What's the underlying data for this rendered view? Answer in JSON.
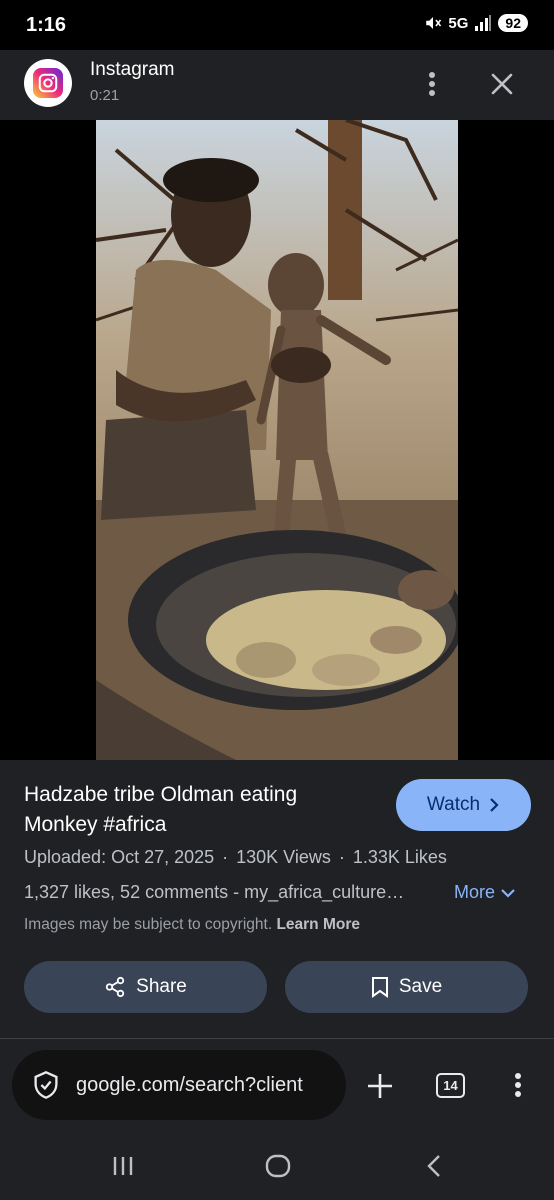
{
  "status_bar": {
    "time": "1:16",
    "network": "5G",
    "battery": "92"
  },
  "header": {
    "app_name": "Instagram",
    "duration": "0:21",
    "app_icon": "instagram-icon",
    "menu_icon": "more-vert-icon",
    "close_icon": "close-icon"
  },
  "media": {
    "image_icon": "video-thumbnail"
  },
  "info": {
    "title": "Hadzabe tribe Oldman eating Monkey #africa",
    "watch_label": "Watch",
    "uploaded": "Uploaded: Oct 27, 2025",
    "views": "130K Views",
    "likes": "1.33K Likes",
    "separator": "·",
    "description": "1,327 likes, 52 comments - my_africa_culture…",
    "more_label": "More",
    "copyright_text": "Images may be subject to copyright.",
    "learn_more": "Learn More",
    "share_label": "Share",
    "save_label": "Save"
  },
  "browser_bar": {
    "url": "google.com/search?client",
    "tab_count": "14",
    "security_icon": "secure-shield-icon",
    "new_tab_icon": "plus-icon",
    "menu_icon": "more-vert-icon"
  },
  "nav_bar": {
    "recents_icon": "recents-icon",
    "home_icon": "home-icon",
    "back_icon": "back-icon"
  },
  "colors": {
    "accent": "#8ab4f8",
    "surface": "#202124",
    "button": "#394457"
  }
}
